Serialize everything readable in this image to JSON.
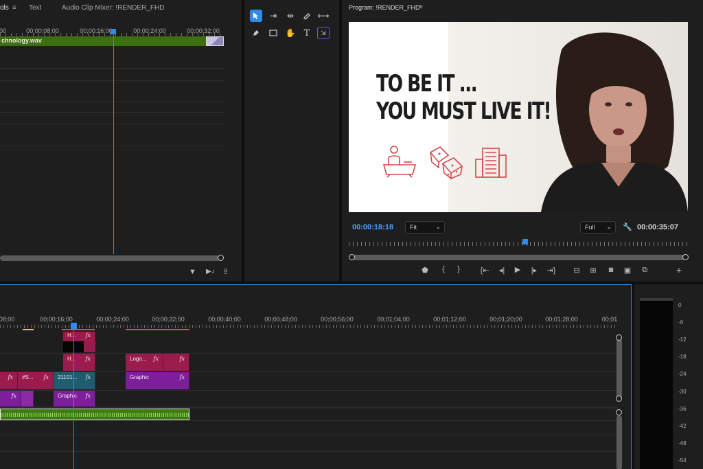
{
  "source_panel": {
    "tabs": [
      {
        "label": "ols",
        "menu_glyph": "≡"
      },
      {
        "label": "Text"
      },
      {
        "label": "Audio Clip Mixer: !RENDER_FHD"
      }
    ],
    "ruler_labels": [
      "00",
      "00;00;08;00",
      "00;00;16;00",
      "00;00;24;00",
      "00;00;32;00"
    ],
    "clip_name": "chnology.wav"
  },
  "tools": [
    "selection-tool",
    "track-select-tool",
    "ripple-edit-tool",
    "razor-tool",
    "slip-tool",
    "pen-tool",
    "rectangle-tool",
    "hand-tool",
    "type-tool",
    "remix-tool"
  ],
  "program_monitor": {
    "title": "Program: !RENDER_FHD",
    "menu_glyph": "≡",
    "video": {
      "line1": "TO BE IT ...",
      "line2": "YOU MUST LIVE IT!"
    },
    "current_timecode": "00:00:18:18",
    "zoom": "Fit",
    "quality": "Full",
    "duration": "00:00:35:07",
    "playhead_fraction": 0.52,
    "controls": [
      "marker",
      "in-point",
      "out-point",
      "go-to-in",
      "step-back",
      "play",
      "step-forward",
      "go-to-out",
      "lift",
      "extract",
      "export-frame",
      "insert",
      "overwrite",
      "add"
    ]
  },
  "timeline": {
    "ruler_labels": [
      "08;00",
      "00;00;16;00",
      "00;00;24;00",
      "00;00;32;00",
      "00;00;40;00",
      "00;00;48;00",
      "00;00;56;00",
      "00;01;04;00",
      "00;01;12;00",
      "00;01;20;00",
      "00;01;28;00",
      "00;01"
    ],
    "clips": {
      "v4_h": "H...",
      "v3_h": "H...",
      "v3_logo": "Logo...",
      "v2_s": "#S...",
      "v2_2110": "21101...",
      "v2_graphic": "Graphic",
      "v1_graphic": "Graphic"
    },
    "fx_label": "fx"
  },
  "audio_meter": {
    "labels": [
      "0",
      "-6",
      "-12",
      "-18",
      "-24",
      "-30",
      "-36",
      "-42",
      "-48",
      "-54"
    ]
  },
  "colors": {
    "accent_blue": "#2d8ceb",
    "clip_magenta": "#9b1b4d",
    "clip_purple": "#7d1f9b",
    "clip_teal": "#1f5d6e",
    "audio_green": "#3d7a14",
    "timecode_blue": "#4aa0ff"
  }
}
